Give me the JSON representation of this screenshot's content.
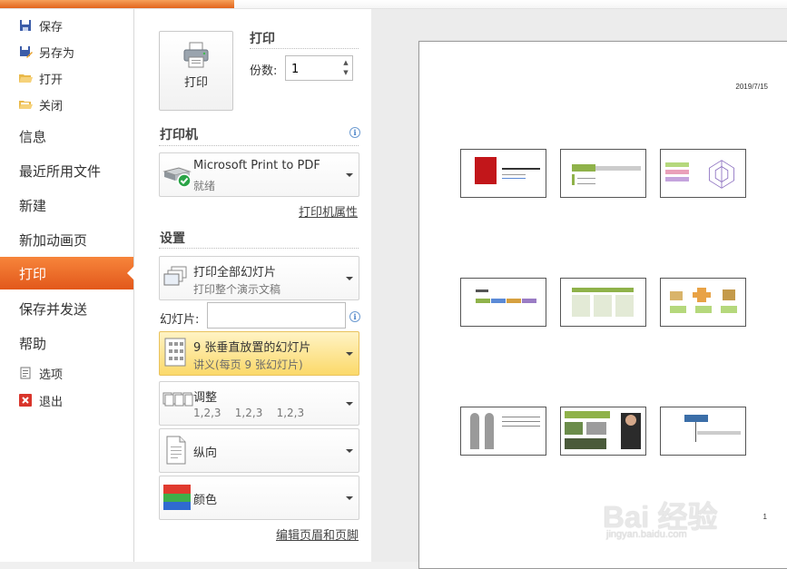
{
  "nav": {
    "save": "保存",
    "save_as": "另存为",
    "open": "打开",
    "close": "关闭",
    "info": "信息",
    "recent": "最近所用文件",
    "new": "新建",
    "add_animation_page": "新加动画页",
    "print": "打印",
    "save_send": "保存并发送",
    "help": "帮助",
    "options": "选项",
    "exit": "退出"
  },
  "print": {
    "title": "打印",
    "button_label": "打印",
    "copies_label": "份数:",
    "copies_value": "1"
  },
  "printer": {
    "section": "打印机",
    "name": "Microsoft Print to PDF",
    "status": "就绪",
    "properties_link": "打印机属性"
  },
  "settings": {
    "section": "设置",
    "range": {
      "label": "打印全部幻灯片",
      "desc": "打印整个演示文稿"
    },
    "slides_label": "幻灯片:",
    "slides_value": "",
    "layout": {
      "label": "9 张垂直放置的幻灯片",
      "desc": "讲义(每页 9 张幻灯片)"
    },
    "collate": {
      "label": "调整",
      "desc": "1,2,3    1,2,3    1,2,3"
    },
    "orientation": {
      "label": "纵向"
    },
    "color": {
      "label": "颜色"
    },
    "header_footer_link": "编辑页眉和页脚"
  },
  "preview": {
    "date": "2019/7/15",
    "page_number": "1"
  },
  "watermark": {
    "text": "Bai 经验",
    "url": "jingyan.baidu.com"
  },
  "colors": {
    "accent_orange": "#e8651e",
    "highlight_yellow": "#fbd96a",
    "link_blue": "#3a78c4"
  }
}
